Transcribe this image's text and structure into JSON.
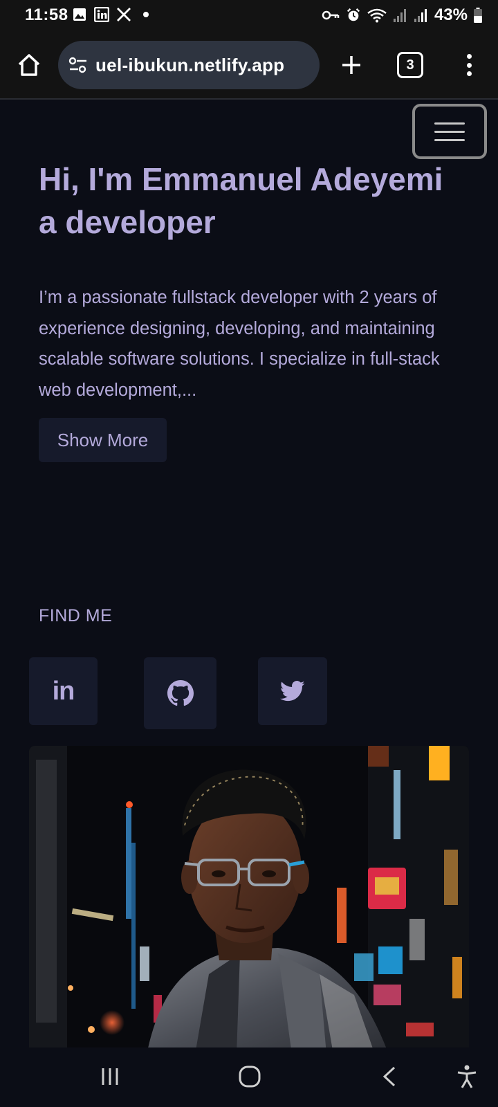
{
  "status_bar": {
    "time": "11:58",
    "left_icons": [
      "gallery-icon",
      "linkedin-icon",
      "x-icon",
      "dot-icon"
    ],
    "right_icons": [
      "key-icon",
      "alarm-icon",
      "wifi-icon",
      "signal-icon",
      "signal-icon",
      "battery-icon"
    ],
    "battery": "43%"
  },
  "browser": {
    "url": "uel-ibukun.netlify.app",
    "tab_count": "3"
  },
  "hero": {
    "title_line1": "Hi, I'm Emmanuel Adeyemi",
    "title_line2": "a developer",
    "description": "I’m a passionate fullstack developer with 2 years of experience designing, developing, and maintaining scalable software solutions. I specialize in full-stack web development,...",
    "show_more_label": "Show More"
  },
  "find_me": {
    "heading": "FIND ME",
    "socials": [
      {
        "name": "linkedin",
        "text": "in"
      },
      {
        "name": "github"
      },
      {
        "name": "twitter"
      }
    ]
  },
  "colors": {
    "background": "#0b0d16",
    "accent_text": "#b4aadb",
    "button_bg": "#161a2b",
    "browser_bar": "#131313",
    "url_pill": "#2e3440"
  }
}
